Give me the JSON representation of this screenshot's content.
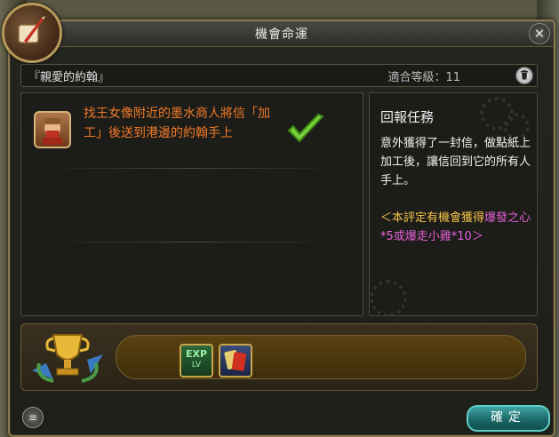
{
  "window": {
    "title": "機會命運",
    "close_symbol": "✕"
  },
  "quest": {
    "name": "『親愛的約翰』",
    "level_requirement": "適合等級：11",
    "delete_icon": "trash-icon"
  },
  "task": {
    "text": "找王女像附近的墨水商人將信「加工」後送到港邊的約翰手上",
    "status": "complete"
  },
  "report": {
    "title": "回報任務",
    "description": "意外獲得了一封信，做點紙上加工後，讓信回到它的所有人手上。",
    "note_gold": "＜本評定有機會獲得",
    "note_pink": "爆發之心*5或爆走小雞*10＞"
  },
  "rewards": {
    "exp_label": "EXP",
    "lv_label": "LV",
    "items": [
      "exp-lv-icon",
      "card-icon"
    ]
  },
  "buttons": {
    "confirm": "確定"
  },
  "colors": {
    "task_text": "#f07a2a",
    "note_gold": "#f4c34a",
    "note_pink": "#e460d8",
    "confirm_button": "#1a6464"
  }
}
